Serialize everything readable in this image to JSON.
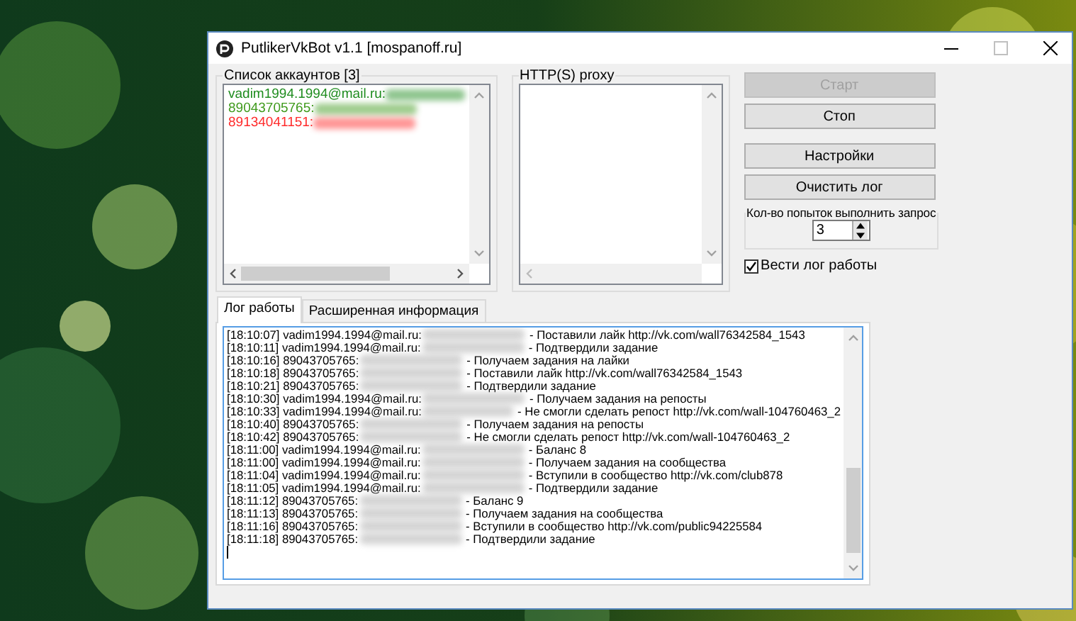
{
  "window": {
    "title": "PutlikerVkBot v1.1 [mospanoff.ru]"
  },
  "accounts_group": {
    "title": "Список аккаунтов [3]",
    "accounts": [
      {
        "text": "vadim1994.1994@mail.ru:",
        "color": "#1e8c1e"
      },
      {
        "text": "89043705765:",
        "color": "#3f9a1c"
      },
      {
        "text": "89134041151:",
        "color": "#ff2a2a"
      }
    ]
  },
  "proxy_group": {
    "title": "HTTP(S) proxy"
  },
  "buttons": [
    {
      "label": "Старт",
      "disabled": true
    },
    {
      "label": "Стоп",
      "disabled": false
    },
    {
      "label": "Настройки",
      "disabled": false
    },
    {
      "label": "Очистить лог",
      "disabled": false
    }
  ],
  "attempts": {
    "label": "Кол-во попыток выполнить запрос",
    "value": "3"
  },
  "log_checkbox": {
    "label": "Вести лог работы",
    "checked": true
  },
  "tabs": [
    {
      "label": "Лог работы",
      "selected": true
    },
    {
      "label": "Расширенная информация",
      "selected": false
    }
  ],
  "log": [
    {
      "time": "[18:10:07]",
      "account": "vadim1994.1994@mail.ru:",
      "message": "- Поставили лайк http://vk.com/wall76342584_1543"
    },
    {
      "time": "[18:10:11]",
      "account": "vadim1994.1994@mail.ru:",
      "message": "- Подтвердили задание"
    },
    {
      "time": "[18:10:16]",
      "account": "89043705765:",
      "message": "- Получаем задания на лайки"
    },
    {
      "time": "[18:10:18]",
      "account": "89043705765:",
      "message": "- Поставили лайк http://vk.com/wall76342584_1543"
    },
    {
      "time": "[18:10:21]",
      "account": "89043705765:",
      "message": "- Подтвердили задание"
    },
    {
      "time": "[18:10:30]",
      "account": "vadim1994.1994@mail.ru:",
      "message": "- Получаем задания на репосты"
    },
    {
      "time": "[18:10:33]",
      "account": "vadim1994.1994@mail.ru:",
      "message": "- Не смогли сделать репост http://vk.com/wall-104760463_2"
    },
    {
      "time": "[18:10:40]",
      "account": "89043705765:",
      "message": "- Получаем задания на репосты"
    },
    {
      "time": "[18:10:42]",
      "account": "89043705765:",
      "message": "- Не смогли сделать репост http://vk.com/wall-104760463_2"
    },
    {
      "time": "[18:11:00]",
      "account": "vadim1994.1994@mail.ru:",
      "message": "- Баланс 8"
    },
    {
      "time": "[18:11:00]",
      "account": "vadim1994.1994@mail.ru:",
      "message": "- Получаем задания на сообщества"
    },
    {
      "time": "[18:11:04]",
      "account": "vadim1994.1994@mail.ru:",
      "message": "- Вступили в сообщество http://vk.com/club878"
    },
    {
      "time": "[18:11:05]",
      "account": "vadim1994.1994@mail.ru:",
      "message": "- Подтвердили задание"
    },
    {
      "time": "[18:11:12]",
      "account": "89043705765:",
      "message": "- Баланс 9"
    },
    {
      "time": "[18:11:13]",
      "account": "89043705765:",
      "message": "- Получаем задания на сообщества"
    },
    {
      "time": "[18:11:16]",
      "account": "89043705765:",
      "message": "- Вступили в сообщество http://vk.com/public94225584"
    },
    {
      "time": "[18:11:18]",
      "account": "89043705765:",
      "message": "- Подтвердили задание"
    }
  ]
}
